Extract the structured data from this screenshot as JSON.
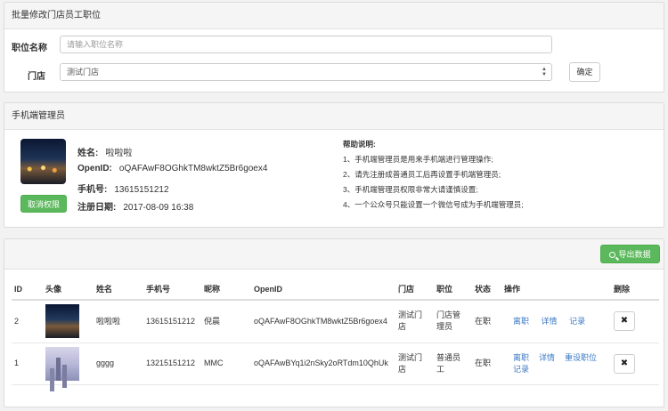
{
  "batch_panel": {
    "title": "批量修改门店员工职位",
    "position_label": "职位名称",
    "position_placeholder": "请输入职位名称",
    "store_label": "门店",
    "store_value": "测试门店",
    "confirm_label": "确定"
  },
  "admin_panel": {
    "title": "手机端管理员",
    "name_label": "姓名:",
    "name_value": "啦啦啦",
    "openid_label": "OpenID:",
    "openid_value": "oQAFAwF8OGhkTM8wktZ5Br6goex4",
    "phone_label": "手机号:",
    "phone_value": "13615151212",
    "date_label": "注册日期:",
    "date_value": "2017-08-09 16:38",
    "cancel_button": "取消权限",
    "help_title": "帮助说明:",
    "help_items": [
      "1、手机端管理员是用来手机端进行管理操作;",
      "2、请先注册成普通员工后再设置手机端管理员;",
      "3、手机端管理员权限非常大请谨慎设置;",
      "4、一个公众号只能设置一个微信号成为手机端管理员;"
    ]
  },
  "staff_table": {
    "export_label": "导出数据",
    "headers": [
      "ID",
      "头像",
      "姓名",
      "手机号",
      "昵称",
      "OpenID",
      "门店",
      "职位",
      "状态",
      "操作",
      "删除"
    ],
    "rows": [
      {
        "id": "2",
        "name": "啦啦啦",
        "phone": "13615151212",
        "nickname": "倪晨",
        "openid": "oQAFAwF8OGhkTM8wktZ5Br6goex4",
        "store_l1": "测试门",
        "store_l2": "店",
        "role_l1": "门店管",
        "role_l2": "理员",
        "status": "在职",
        "action1": "离职",
        "action2": "详情",
        "action3": "记录",
        "avatar_icon": "night-city-avatar"
      },
      {
        "id": "1",
        "name": "gggg",
        "phone": "13215151212",
        "nickname": "MMC",
        "openid": "oQAFAwBYq1i2nSky2oRTdm10QhUk",
        "store_l1": "测试门",
        "store_l2": "店",
        "role_l1": "普通员",
        "role_l2": "工",
        "status": "在职",
        "action1": "离职",
        "action1b": "记录",
        "action2": "详情",
        "action3": "重设职位",
        "avatar_icon": "skyline-avatar"
      }
    ],
    "delete_symbol": "✖"
  },
  "colors": {
    "primary_green": "#5cb85c",
    "link_blue": "#3b78c3"
  }
}
